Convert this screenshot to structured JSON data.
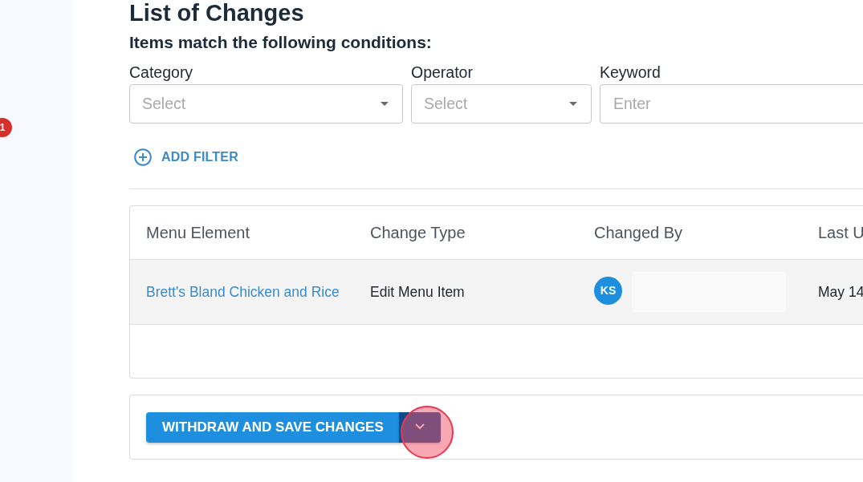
{
  "sidebar": {
    "badge": "1"
  },
  "page": {
    "title": "List of Changes"
  },
  "filters": {
    "heading": "Items match the following conditions:",
    "fields": [
      {
        "kind": "select",
        "label": "Category",
        "placeholder": "Select"
      },
      {
        "kind": "select",
        "label": "Operator",
        "placeholder": "Select"
      },
      {
        "kind": "text",
        "label": "Keyword",
        "placeholder": "Enter"
      }
    ],
    "add_filter": "ADD FILTER"
  },
  "table": {
    "columns": [
      "Menu Element",
      "Change Type",
      "Changed By",
      "Last U"
    ],
    "rows": [
      {
        "cells": [
          {
            "kind": "link",
            "text": "Brett's Bland Chicken and Rice"
          },
          {
            "kind": "text",
            "text": "Edit Menu Item"
          },
          {
            "kind": "user",
            "initials": "KS"
          },
          {
            "kind": "text",
            "text": "May 14"
          }
        ]
      }
    ]
  },
  "actions": {
    "primary": "WITHDRAW AND SAVE CHANGES",
    "dropdown": {
      "highlighted": true
    }
  }
}
